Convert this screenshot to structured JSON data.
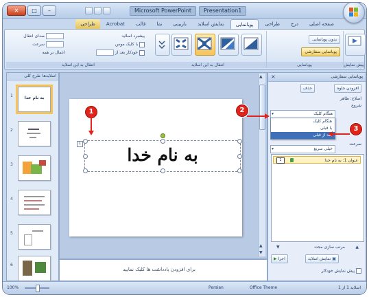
{
  "window": {
    "title_left": "Microsoft PowerPoint",
    "title_right": "Presentation1",
    "close_glyph": "✕",
    "max_glyph": "□",
    "min_glyph": "–"
  },
  "ribbon": {
    "tabs": [
      "صفحه اصلی",
      "درج",
      "طراحی",
      "پویانمایی",
      "نمایش اسلاید",
      "بازبینی",
      "نما",
      "قالب",
      "Acrobat",
      "طراحی"
    ],
    "active_tab_index": 3,
    "group_labels": [
      "پیش نمایش",
      "پویانمایی",
      "انتقال به این اسلاید",
      "انتقال به این اسلاید"
    ],
    "preview_label": "پیش نمایش",
    "animate_label": "بدون پویانمایی",
    "custom_anim_label": "پویانمایی سفارشی",
    "sound_label": "صدای انتقال",
    "speed_label": "سرعت",
    "apply_all_label": "اعمال بر همه",
    "advance_label": "پیشبرد اسلاید",
    "on_click_label": "با کلیک موس",
    "auto_label": "خودکار بعد از"
  },
  "slide_pane": {
    "tabs": [
      "طرح کلی",
      "اسلایدها"
    ],
    "slide_numbers": [
      "1",
      "2",
      "3",
      "4",
      "5",
      "6"
    ],
    "slide1_title": "به نام خدا"
  },
  "slide": {
    "title_text": "به نام خدا",
    "notes_placeholder": "برای افزودن یادداشت ها کلیک نمایید"
  },
  "task_pane": {
    "title": "پویانمایی سفارشی",
    "add_effect": "افزودن جلوه",
    "remove": "حذف",
    "section_label": "اصلاح: ظاهر",
    "start_label": "شروع",
    "start_value": "هنگام کلیک",
    "dropdown_options": [
      "هنگام کلیک",
      "با قبلی",
      "بعد از قبلی"
    ],
    "dropdown_selected_index": 2,
    "speed_label": "سرعت",
    "speed_value": "خیلی سریع",
    "list_item": "عنوان 1: به نام خدا",
    "list_item_number": "1",
    "reorder_label": "مرتب سازی مجدد",
    "play_button": "اجرا",
    "slideshow_button": "نمایش اسلاید",
    "autopreview_label": "پیش نمایش خودکار"
  },
  "status": {
    "slide_count": "اسلاید 1 از 1",
    "theme": "Office Theme",
    "language": "Persian",
    "zoom": "100%"
  },
  "callouts": [
    "1",
    "2",
    "3"
  ],
  "colors": {
    "callout": "#e0241b",
    "ribbon_bg": "#d3e1f3",
    "highlight": "#f6c35a",
    "selection": "#3f6fb8"
  }
}
